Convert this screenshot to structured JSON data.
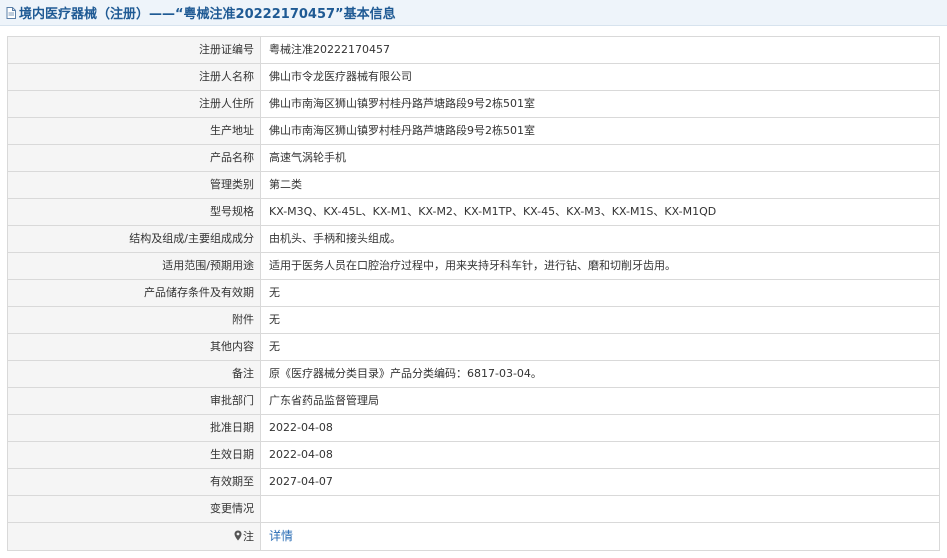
{
  "header": {
    "title": "境内医疗器械（注册）——“粤械注准20222170457”基本信息"
  },
  "rows": [
    {
      "label": "注册证编号",
      "value": "粤械注准20222170457"
    },
    {
      "label": "注册人名称",
      "value": "佛山市令龙医疗器械有限公司"
    },
    {
      "label": "注册人住所",
      "value": "佛山市南海区狮山镇罗村桂丹路芦塘路段9号2栋501室"
    },
    {
      "label": "生产地址",
      "value": "佛山市南海区狮山镇罗村桂丹路芦塘路段9号2栋501室"
    },
    {
      "label": "产品名称",
      "value": "高速气涡轮手机"
    },
    {
      "label": "管理类别",
      "value": "第二类"
    },
    {
      "label": "型号规格",
      "value": "KX-M3Q、KX-45L、KX-M1、KX-M2、KX-M1TP、KX-45、KX-M3、KX-M1S、KX-M1QD"
    },
    {
      "label": "结构及组成/主要组成成分",
      "value": "由机头、手柄和接头组成。"
    },
    {
      "label": "适用范围/预期用途",
      "value": "适用于医务人员在口腔治疗过程中，用来夹持牙科车针，进行钻、磨和切削牙齿用。"
    },
    {
      "label": "产品储存条件及有效期",
      "value": "无"
    },
    {
      "label": "附件",
      "value": "无"
    },
    {
      "label": "其他内容",
      "value": "无"
    },
    {
      "label": "备注",
      "value": "原《医疗器械分类目录》产品分类编码：6817-03-04。"
    },
    {
      "label": "审批部门",
      "value": "广东省药品监督管理局"
    },
    {
      "label": "批准日期",
      "value": "2022-04-08"
    },
    {
      "label": "生效日期",
      "value": "2022-04-08"
    },
    {
      "label": "有效期至",
      "value": "2027-04-07"
    },
    {
      "label": "变更情况",
      "value": ""
    }
  ],
  "note_row": {
    "label": "注",
    "link_text": "详情",
    "icon": "location-pin-icon"
  }
}
